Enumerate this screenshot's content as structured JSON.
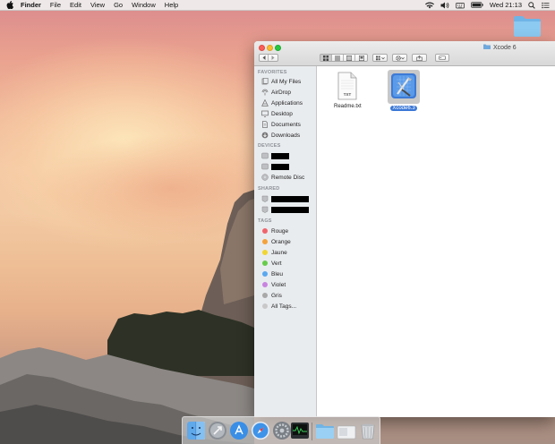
{
  "menubar": {
    "app_name": "Finder",
    "items": [
      "File",
      "Edit",
      "View",
      "Go",
      "Window",
      "Help"
    ],
    "clock": "Wed 21:13"
  },
  "window": {
    "title": "Xcode 6"
  },
  "sidebar": {
    "favorites_header": "FAVORITES",
    "favorites": [
      {
        "label": "All My Files",
        "icon": "all-files-icon"
      },
      {
        "label": "AirDrop",
        "icon": "airdrop-icon"
      },
      {
        "label": "Applications",
        "icon": "applications-icon"
      },
      {
        "label": "Desktop",
        "icon": "desktop-icon"
      },
      {
        "label": "Documents",
        "icon": "documents-icon"
      },
      {
        "label": "Downloads",
        "icon": "downloads-icon"
      }
    ],
    "devices_header": "DEVICES",
    "devices": [
      {
        "label": "",
        "icon": "drive-icon",
        "redacted": true
      },
      {
        "label": "",
        "icon": "drive-icon",
        "redacted": true
      },
      {
        "label": "Remote Disc",
        "icon": "remote-disc-icon"
      }
    ],
    "shared_header": "SHARED",
    "shared": [
      {
        "label": "",
        "icon": "shared-computer-icon",
        "redacted": true
      },
      {
        "label": "",
        "icon": "shared-computer-icon",
        "redacted": true
      }
    ],
    "tags_header": "TAGS",
    "tags": [
      {
        "label": "Rouge",
        "color": "#f0646c"
      },
      {
        "label": "Orange",
        "color": "#f5a23b"
      },
      {
        "label": "Jaune",
        "color": "#f1d631"
      },
      {
        "label": "Vert",
        "color": "#67cc4a"
      },
      {
        "label": "Bleu",
        "color": "#5aa8f0"
      },
      {
        "label": "Violet",
        "color": "#c884e0"
      },
      {
        "label": "Gris",
        "color": "#a8a8a8"
      },
      {
        "label": "All Tags...",
        "color": "#c8c8c8"
      }
    ]
  },
  "files": [
    {
      "name": "Readme.txt",
      "icon": "text-file-icon",
      "badge": "TXT",
      "selected": false
    },
    {
      "name": "Xcode6.3",
      "icon": "xcode-app-icon",
      "selected": true
    }
  ],
  "dock": {
    "apps": [
      "finder-icon",
      "launchpad-icon",
      "app-store-icon",
      "safari-icon",
      "system-preferences-icon",
      "activity-monitor-icon",
      "folder-icon",
      "downloads-stack-icon",
      "trash-icon"
    ]
  }
}
